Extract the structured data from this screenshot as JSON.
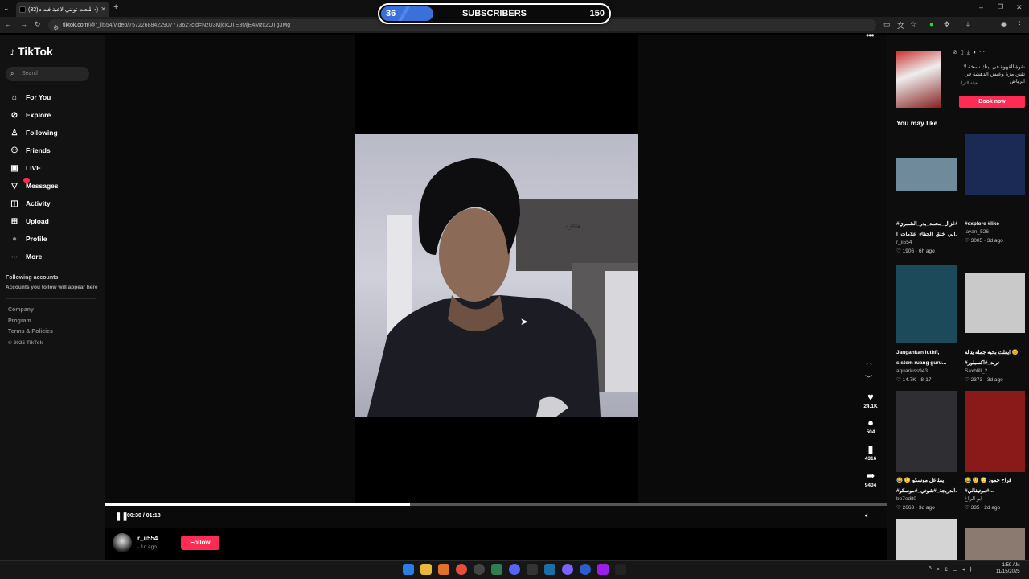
{
  "browser": {
    "tab_title": "(32)طلعت تونني لاعبة فيه م...",
    "url_host": "tiktok.com",
    "url_path": "/@r_ii554/video/7572268842290777362?cid=NzU3MjcxOTE3MjE4Mzc2OTg3Mg"
  },
  "overlay": {
    "count": "36",
    "label": "SUBSCRIBERS",
    "goal": "150"
  },
  "sidebar": {
    "logo": "TikTok",
    "search_placeholder": "Search",
    "items": [
      {
        "label": "For You",
        "icon": "home-icon"
      },
      {
        "label": "Explore",
        "icon": "compass-icon"
      },
      {
        "label": "Following",
        "icon": "person-follow-icon"
      },
      {
        "label": "Friends",
        "icon": "friends-icon"
      },
      {
        "label": "LIVE",
        "icon": "live-icon"
      },
      {
        "label": "Messages",
        "icon": "message-icon"
      },
      {
        "label": "Activity",
        "icon": "activity-icon"
      },
      {
        "label": "Upload",
        "icon": "upload-icon"
      },
      {
        "label": "Profile",
        "icon": "profile-icon"
      },
      {
        "label": "More",
        "icon": "more-icon"
      }
    ],
    "following_accounts_title": "Following accounts",
    "following_accounts_note": "Accounts you follow will appear here",
    "footer": [
      "Company",
      "Program",
      "Terms & Policies",
      "© 2025 TikTok"
    ]
  },
  "video": {
    "watermark": "r_ii554",
    "likes": "24.1K",
    "comments": "504",
    "saves": "4316",
    "shares": "9404",
    "time": "00:30 / 01:18",
    "progress": 0.39,
    "author": "r_ii554",
    "posted": "· 1d ago",
    "follow_label": "Follow"
  },
  "ad": {
    "text": "نقوة القهوة في بيتك نسخة لا تقنن مزة وعيش الدهشة في الرياض",
    "source": "هيئة الترك",
    "cta": "Book now"
  },
  "you_may_like": {
    "title": "You may like",
    "cards": [
      {
        "title": "#غزال_محمد_بدر_الشمري#",
        "title2": "الي_خلق_الجفا#_علامات_ا...",
        "user": "r_ii554",
        "likes": "1906",
        "ago": "6h ago",
        "thumb": "#6f8a9a"
      },
      {
        "title": "#explore #like",
        "title2": "",
        "user": "layan_526",
        "likes": "3005",
        "ago": "3d ago",
        "thumb": "#1a2a55"
      },
      {
        "title": "Jangankan luthfi,",
        "title2": "sistem ruang guru...",
        "user": "aquariuss943",
        "likes": "14.7K",
        "ago": "8-17",
        "thumb": "#1d4a5a"
      },
      {
        "title": "ايقلت بحبه جمله يثاله 😊",
        "title2": "#ترند_#اكسبلور",
        "user": "Saxbfill_2",
        "likes": "2373",
        "ago": "3d ago",
        "thumb": "#c9c9c9"
      },
      {
        "title": "😂 🙂 يمثاعل موسكو",
        "title2": "#الدربجة_#شوتي_#موسكو...",
        "user": "bo7edit0",
        "likes": "2663",
        "ago": "3d ago",
        "thumb": "#2e2e33"
      },
      {
        "title": "😂 🙂 😳 فراح حمود",
        "title2": "#موتيفالي#...",
        "user": "ابو الراغ",
        "likes": "335",
        "ago": "2d ago",
        "thumb": "#8a1a1a"
      }
    ]
  },
  "taskbar": {
    "time": "1:59 AM",
    "date": "11/15/2025"
  }
}
